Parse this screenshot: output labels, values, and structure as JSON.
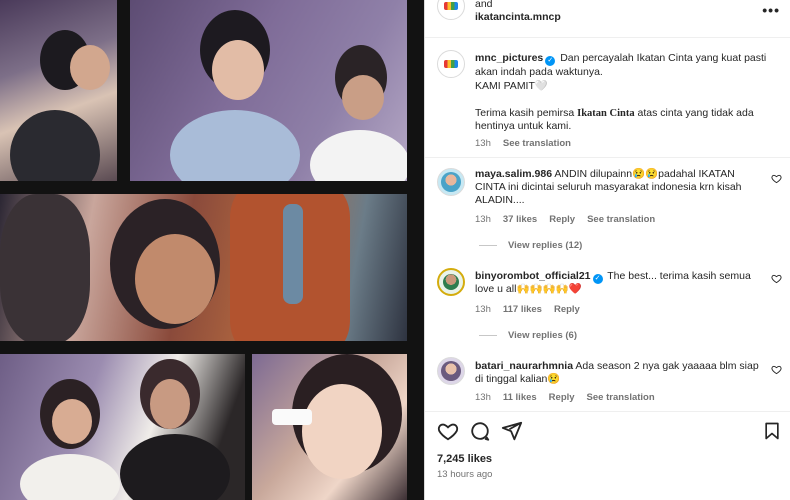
{
  "header": {
    "line1": "and",
    "line2": "ikatancinta.mncp",
    "more_icon": "•••"
  },
  "caption": {
    "username": "mnc_pictures",
    "line1": "Dan percayalah Ikatan Cinta yang kuat pasti",
    "line2": "akan indah pada waktunya.",
    "line3": "KAMI PAMIT🤍",
    "line4a": "Terima kasih pemirsa ",
    "line4b": "Ikatan Cinta",
    "line4c": " atas cinta yang tidak ada",
    "line5": "hentinya untuk kami.",
    "time": "13h",
    "see_translation": "See translation"
  },
  "comments": [
    {
      "username": "maya.salim.986",
      "line1": "ANDIN dilupainn😢😢padahal IKATAN",
      "line2": "CINTA ini dicintai seluruh masyarakat indonesia krn kisah",
      "line3": "ALADIN....",
      "time": "13h",
      "likes": "37 likes",
      "reply": "Reply",
      "see_translation": "See translation",
      "view_replies": "View replies (12)"
    },
    {
      "username": "binyorombot_official21",
      "line1": "The best... terima kasih semua",
      "line2": "love u all🙌🙌🙌🙌❤️",
      "time": "13h",
      "likes": "117 likes",
      "reply": "Reply",
      "view_replies": "View replies (6)"
    },
    {
      "username": "batari_naurarhmnia",
      "line1": "Ada season 2 nya gak yaaaaa blm siap",
      "line2": "di tinggal kalian😢",
      "time": "13h",
      "likes": "11 likes",
      "reply": "Reply",
      "see_translation": "See translation"
    }
  ],
  "footer": {
    "likes": "7,245 likes",
    "time_ago": "13 hours ago"
  },
  "colors": {
    "verified": "#0095f6",
    "text": "#262626",
    "muted": "#737373"
  }
}
